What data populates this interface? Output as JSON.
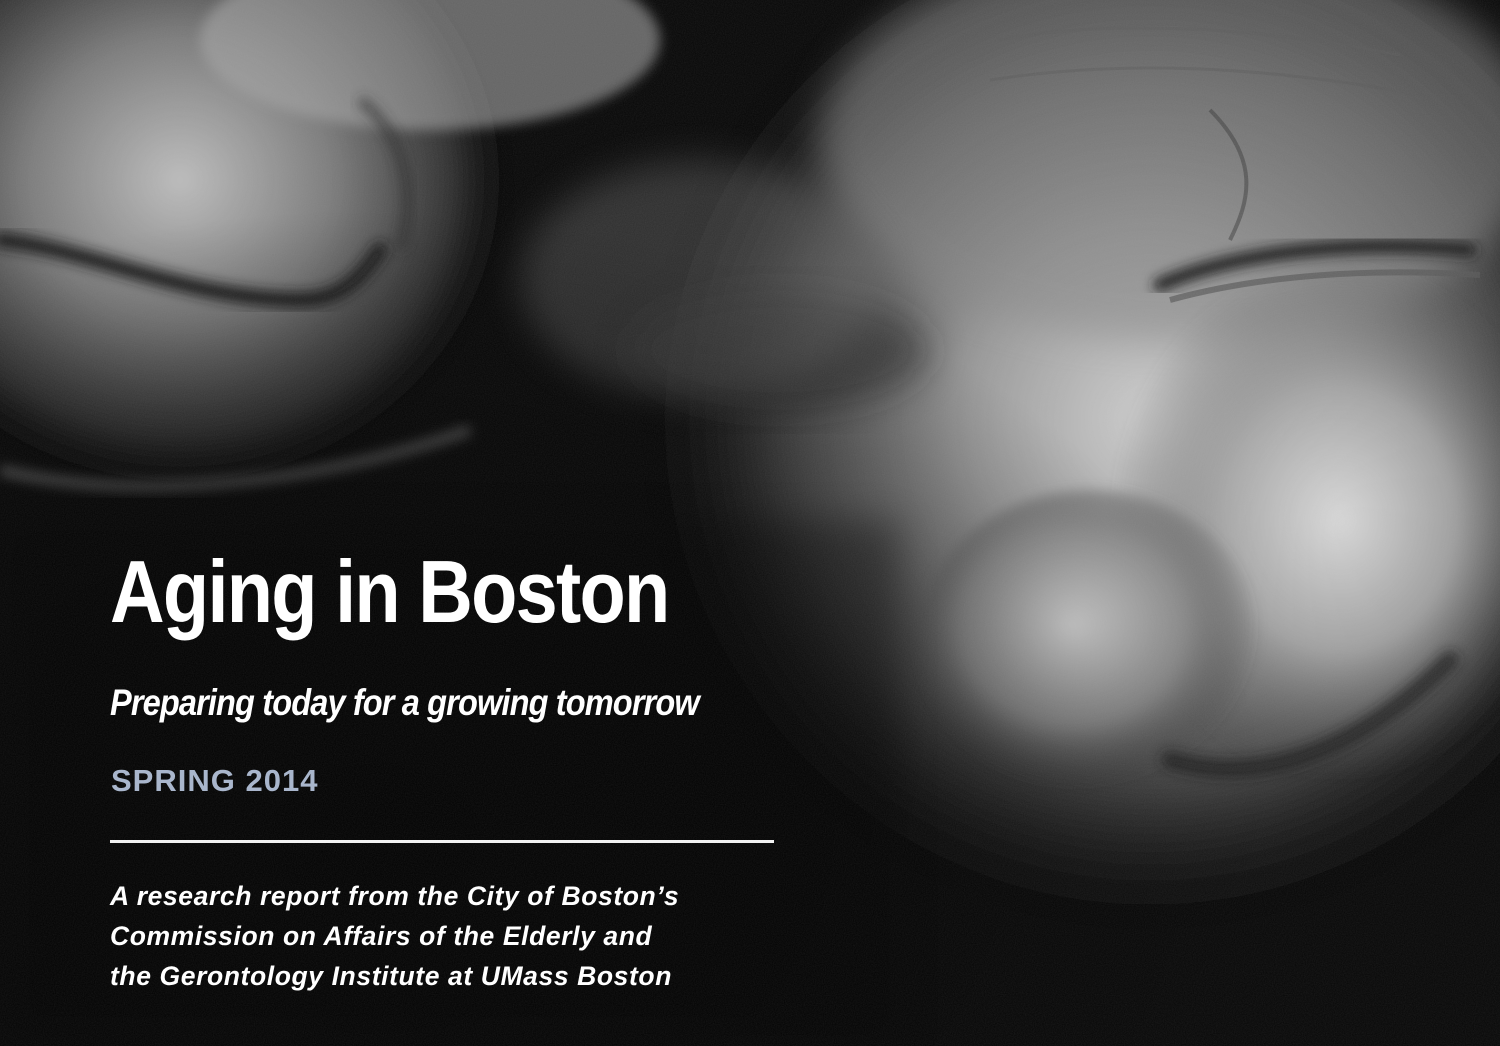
{
  "cover": {
    "title": "Aging in Boston",
    "subtitle": "Preparing today for a growing tomorrow",
    "season": "SPRING 2014",
    "description_lines": [
      "A research report from the City of Boston’s",
      "Commission on Affairs of the Elderly and",
      "the Gerontology Institute at UMass Boston"
    ],
    "photo": "black-and-white close-up photograph of two elderly faces",
    "colors": {
      "background": "#050505",
      "title": "#ffffff",
      "season_accent": "#a9b6cc",
      "rule": "#f2f2f2"
    }
  }
}
